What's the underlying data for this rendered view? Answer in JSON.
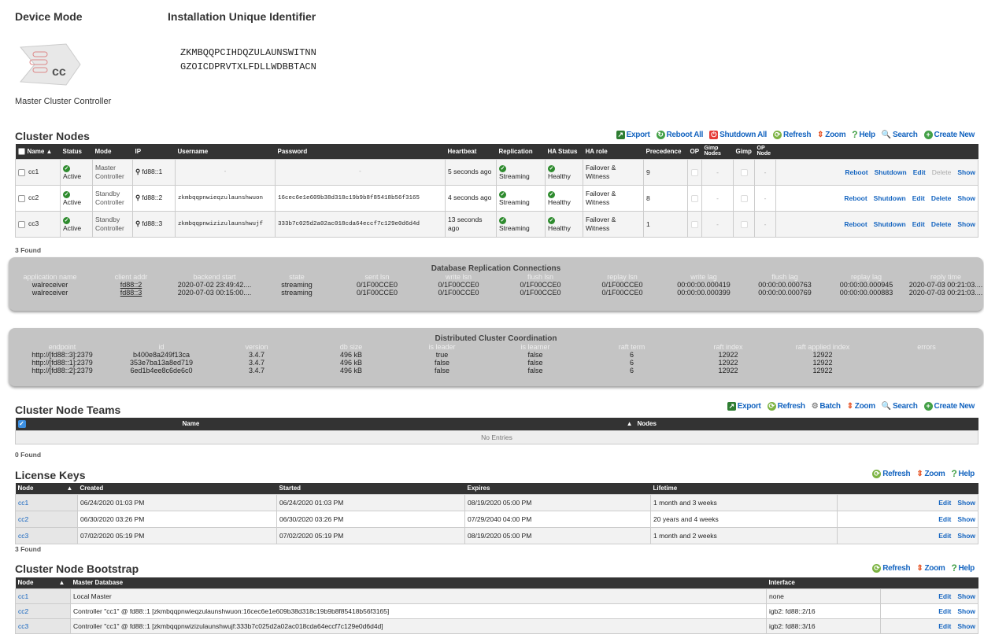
{
  "header": {
    "device_mode_label": "Device Mode",
    "uid_label": "Installation Unique Identifier",
    "uid_line1": "ZKMBQQPCIHDQZULAUNSWITNN",
    "uid_line2": "GZOICDPRVTXLFDLLWDBBTACN",
    "device_mode_value": "Master Cluster Controller",
    "logo_text": "cc"
  },
  "cluster_nodes": {
    "title": "Cluster Nodes",
    "toolbar": [
      "Export",
      "Reboot All",
      "Shutdown All",
      "Refresh",
      "Zoom",
      "Help",
      "Search",
      "Create New"
    ],
    "columns": [
      "Name",
      "Status",
      "Mode",
      "IP",
      "Username",
      "Password",
      "Heartbeat",
      "Replication",
      "HA Status",
      "HA role",
      "Precedence",
      "OP",
      "Gimp Nodes",
      "Gimp",
      "OP Node"
    ],
    "rows": [
      {
        "name": "cc1",
        "status": "Active",
        "mode": "Master Controller",
        "ip": "fd88::1",
        "username": "-",
        "password": "-",
        "heartbeat": "5 seconds ago",
        "replication": "Streaming",
        "ha_status": "Healthy",
        "ha_role": "Failover & Witness",
        "precedence": "9",
        "gimp_nodes": "-",
        "op_node": "-",
        "actions": [
          "Reboot",
          "Shutdown",
          "Edit",
          "Delete",
          "Show"
        ]
      },
      {
        "name": "cc2",
        "status": "Active",
        "mode": "Standby Controller",
        "ip": "fd88::2",
        "username": "zkmbqqpnwieqzulaunshwuon",
        "password": "16cec6e1e609b38d318c19b9b8f85418b56f3165",
        "heartbeat": "4 seconds ago",
        "replication": "Streaming",
        "ha_status": "Healthy",
        "ha_role": "Failover & Witness",
        "precedence": "8",
        "gimp_nodes": "-",
        "op_node": "-",
        "actions": [
          "Reboot",
          "Shutdown",
          "Edit",
          "Delete",
          "Show"
        ]
      },
      {
        "name": "cc3",
        "status": "Active",
        "mode": "Standby Controller",
        "ip": "fd88::3",
        "username": "zkmbqqpnwizizulaunshwujf",
        "password": "333b7c025d2a02ac018cda64eccf7c129e0d6d4d",
        "heartbeat": "13 seconds ago",
        "replication": "Streaming",
        "ha_status": "Healthy",
        "ha_role": "Failover & Witness",
        "precedence": "1",
        "gimp_nodes": "-",
        "op_node": "-",
        "actions": [
          "Reboot",
          "Shutdown",
          "Edit",
          "Delete",
          "Show"
        ]
      }
    ],
    "found": "3 Found"
  },
  "replication": {
    "title": "Database Replication Connections",
    "columns": [
      "application name",
      "client addr",
      "backend start",
      "state",
      "sent lsn",
      "write lsn",
      "flush lsn",
      "replay lsn",
      "write lag",
      "flush lag",
      "replay lag",
      "reply time"
    ],
    "rows": [
      [
        "walreceiver",
        "fd88::2",
        "2020-07-02 23:49:42....",
        "streaming",
        "0/1F00CCE0",
        "0/1F00CCE0",
        "0/1F00CCE0",
        "0/1F00CCE0",
        "00:00:00.000419",
        "00:00:00.000763",
        "00:00:00.000945",
        "2020-07-03 00:21:03...."
      ],
      [
        "walreceiver",
        "fd88::3",
        "2020-07-03 00:15:00....",
        "streaming",
        "0/1F00CCE0",
        "0/1F00CCE0",
        "0/1F00CCE0",
        "0/1F00CCE0",
        "00:00:00.000399",
        "00:00:00.000769",
        "00:00:00.000883",
        "2020-07-03 00:21:03...."
      ]
    ]
  },
  "coordination": {
    "title": "Distributed Cluster Coordination",
    "columns": [
      "endpoint",
      "id",
      "version",
      "db size",
      "is leader",
      "is learner",
      "raft term",
      "raft index",
      "raft applied index",
      "errors"
    ],
    "rows": [
      [
        "http://[fd88::3]:2379",
        "b400e8a249f13ca",
        "3.4.7",
        "496 kB",
        "true",
        "false",
        "6",
        "12922",
        "12922",
        ""
      ],
      [
        "http://[fd88::1]:2379",
        "353e7ba13a8ed719",
        "3.4.7",
        "496 kB",
        "false",
        "false",
        "6",
        "12922",
        "12922",
        ""
      ],
      [
        "http://[fd88::2]:2379",
        "6ed1b4ee8c6de6c0",
        "3.4.7",
        "496 kB",
        "false",
        "false",
        "6",
        "12922",
        "12922",
        ""
      ]
    ]
  },
  "teams": {
    "title": "Cluster Node Teams",
    "toolbar": [
      "Export",
      "Refresh",
      "Batch",
      "Zoom",
      "Search",
      "Create New"
    ],
    "columns": [
      "Name",
      "Nodes"
    ],
    "empty": "No Entries",
    "found": "0 Found"
  },
  "license": {
    "title": "License Keys",
    "toolbar": [
      "Refresh",
      "Zoom",
      "Help"
    ],
    "columns": [
      "Node",
      "Created",
      "Started",
      "Expires",
      "Lifetime"
    ],
    "rows": [
      {
        "node": "cc1",
        "created": "06/24/2020 01:03 PM",
        "started": "06/24/2020 01:03 PM",
        "expires": "08/19/2020 05:00 PM",
        "lifetime": "1 month and 3 weeks"
      },
      {
        "node": "cc2",
        "created": "06/30/2020 03:26 PM",
        "started": "06/30/2020 03:26 PM",
        "expires": "07/29/2040 04:00 PM",
        "lifetime": "20 years and 4 weeks"
      },
      {
        "node": "cc3",
        "created": "07/02/2020 05:19 PM",
        "started": "07/02/2020 05:19 PM",
        "expires": "08/19/2020 05:00 PM",
        "lifetime": "1 month and 2 weeks"
      }
    ],
    "actions": [
      "Edit",
      "Show"
    ],
    "found": "3 Found"
  },
  "bootstrap": {
    "title": "Cluster Node Bootstrap",
    "toolbar": [
      "Refresh",
      "Zoom",
      "Help"
    ],
    "columns": [
      "Node",
      "Master Database",
      "Interface"
    ],
    "rows": [
      {
        "node": "cc1",
        "master": "Local Master",
        "interface": "none"
      },
      {
        "node": "cc2",
        "master": "Controller \"cc1\" @ fd88::1 [zkmbqqpnwieqzulaunshwuon:16cec6e1e609b38d318c19b9b8f85418b56f3165]",
        "interface": "igb2: fd88::2/16"
      },
      {
        "node": "cc3",
        "master": "Controller \"cc1\" @ fd88::1 [zkmbqqpnwizizulaunshwujf:333b7c025d2a02ac018cda64eccf7c129e0d6d4d]",
        "interface": "igb2: fd88::3/16"
      }
    ],
    "actions": [
      "Edit",
      "Show"
    ]
  }
}
